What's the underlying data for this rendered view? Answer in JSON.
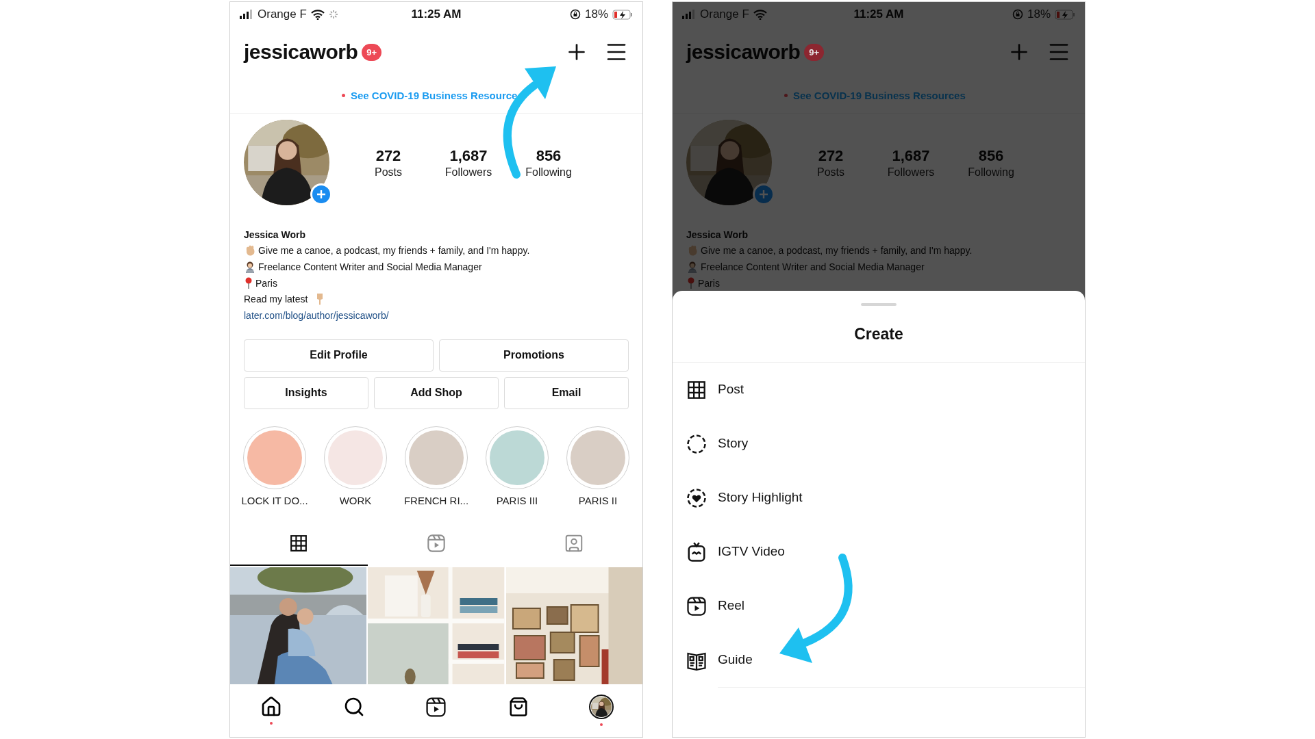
{
  "left_screen": {
    "status_bar": {
      "carrier": "Orange F",
      "loading": true,
      "time": "11:25 AM",
      "battery": "18%"
    },
    "header": {
      "username": "jessicaworb",
      "badge": "9+"
    },
    "banner": {
      "text": "See COVID-19 Business Resource"
    },
    "profile": {
      "avatar": {
        "kind": "picture"
      },
      "stats": [
        {
          "value": "272",
          "label": "Posts"
        },
        {
          "value": "1,687",
          "label": "Followers"
        },
        {
          "value": "856",
          "label": "Following"
        }
      ],
      "name": "Jessica Worb",
      "bio": [
        {
          "kind": "wave",
          "text": "Give me a canoe, a podcast, my friends + family, and I'm happy."
        },
        {
          "kind": "technologist",
          "text": "Freelance Content Writer and Social Media Manager"
        },
        {
          "kind": "pin",
          "text": "Paris"
        },
        {
          "kind": "pointing",
          "text": "Read my latest"
        }
      ],
      "link": "later.com/blog/author/jessicaworb/"
    },
    "action_rows": [
      [
        "Edit Profile",
        "Promotions"
      ],
      [
        "Insights",
        "Add Shop",
        "Email"
      ]
    ],
    "highlights": [
      {
        "label": "LOCK IT DO...",
        "color": "#f6b9a4"
      },
      {
        "label": "WORK",
        "color": "#f5e6e4"
      },
      {
        "label": "FRENCH RI...",
        "color": "#d9cec5"
      },
      {
        "label": "PARIS III",
        "color": "#bcd9d6"
      },
      {
        "label": "PARIS II",
        "color": "#d9cec5"
      }
    ],
    "content_tabs": [
      {
        "kind": "grid",
        "selected": true
      },
      {
        "kind": "reels",
        "selected": false
      },
      {
        "kind": "tagged",
        "selected": false
      }
    ],
    "grid": [
      {
        "kind": "picture"
      },
      {
        "kind": "picture"
      },
      {
        "kind": "picture"
      }
    ],
    "bottom_nav": [
      {
        "kind": "home",
        "dot": true
      },
      {
        "kind": "search",
        "dot": false
      },
      {
        "kind": "reels",
        "dot": false
      },
      {
        "kind": "shop",
        "dot": false
      },
      {
        "kind": "profile",
        "dot": true
      }
    ]
  },
  "right_screen": {
    "dimmed": true,
    "status_bar": {
      "carrier": "Orange F",
      "loading": false,
      "time": "11:25 AM",
      "battery": "18%"
    },
    "header": {
      "username": "jessicaworb",
      "badge": "9+"
    },
    "banner": {
      "text": "See COVID-19 Business Resources"
    },
    "profile": {
      "avatar": {
        "kind": "picture"
      },
      "stats": [
        {
          "value": "272",
          "label": "Posts"
        },
        {
          "value": "1,687",
          "label": "Followers"
        },
        {
          "value": "856",
          "label": "Following"
        }
      ],
      "name": "Jessica Worb",
      "bio": [
        {
          "kind": "wave",
          "text": "Give me a canoe, a podcast, my friends + family, and I'm happy."
        },
        {
          "kind": "technologist",
          "text": "Freelance Content Writer and Social Media Manager"
        },
        {
          "kind": "pin",
          "text": "Paris"
        }
      ]
    },
    "create_sheet": {
      "title": "Create",
      "items": [
        {
          "kind": "post",
          "label": "Post"
        },
        {
          "kind": "story",
          "label": "Story"
        },
        {
          "kind": "highlight",
          "label": "Story Highlight"
        },
        {
          "kind": "igtv",
          "label": "IGTV Video"
        },
        {
          "kind": "reel",
          "label": "Reel"
        },
        {
          "kind": "guide",
          "label": "Guide"
        }
      ]
    }
  }
}
